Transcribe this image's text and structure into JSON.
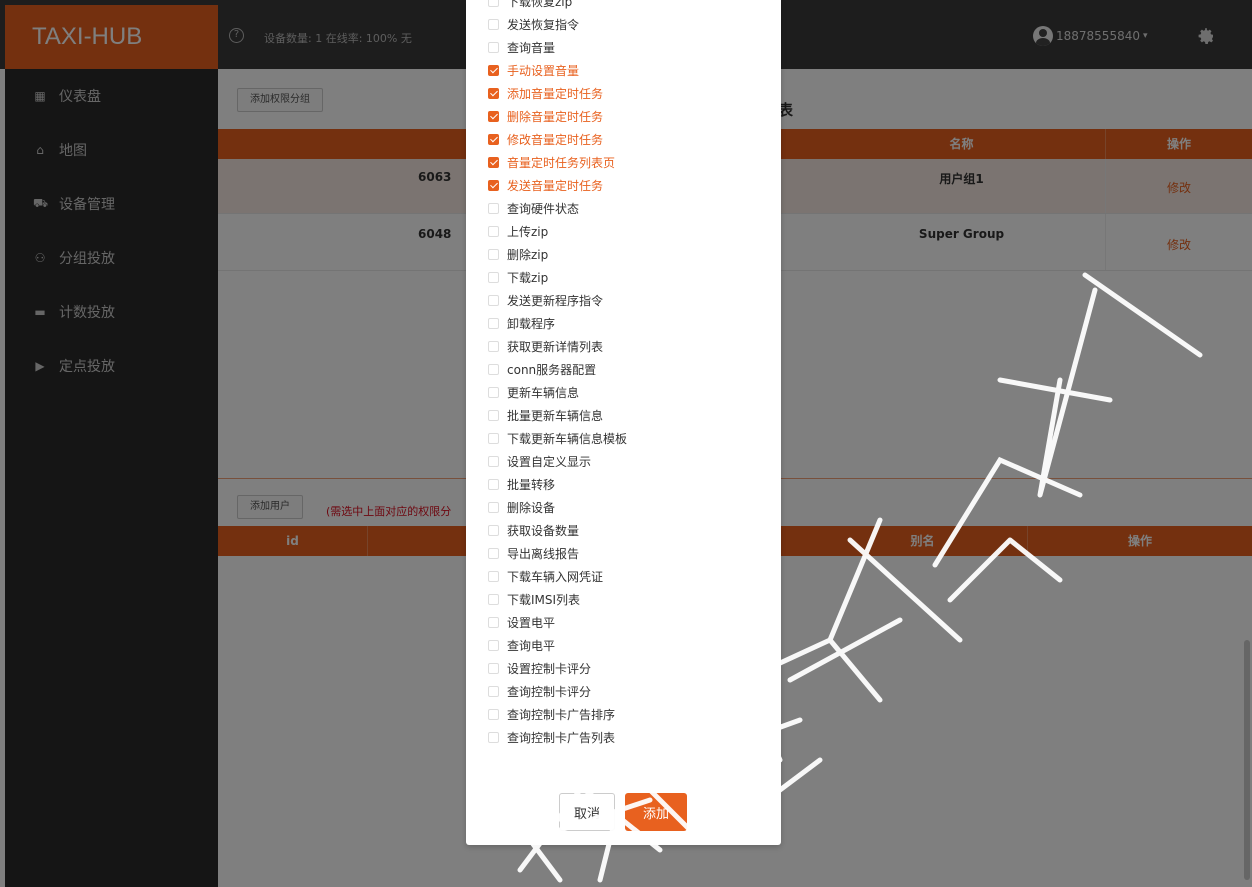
{
  "header": {
    "brand": "TAXI-HUB",
    "help_glyph": "?",
    "stats": "设备数量: 1  在线率: 100%  无",
    "user": "18878555840",
    "colors": {
      "accent": "#e8611f",
      "header_bg": "#3a3a3a",
      "sidebar_bg": "#2b2b2b"
    }
  },
  "sidebar": {
    "items": [
      {
        "label": "仪表盘",
        "icon": "dashboard-icon",
        "glyph": "▦"
      },
      {
        "label": "地图",
        "icon": "map-icon",
        "glyph": "⌂"
      },
      {
        "label": "设备管理",
        "icon": "car-icon",
        "glyph": "⛟"
      },
      {
        "label": "分组投放",
        "icon": "group-icon",
        "glyph": "⚇"
      },
      {
        "label": "计数投放",
        "icon": "counter-icon",
        "glyph": "▬"
      },
      {
        "label": "定点投放",
        "icon": "play-icon",
        "glyph": "▶"
      }
    ]
  },
  "groups": {
    "add_button": "添加权限分组",
    "title_partial": "表",
    "headers": [
      "名称",
      "操作"
    ],
    "rows": [
      {
        "id_partial": "6063",
        "name": "用户组1",
        "action": "修改"
      },
      {
        "id_partial": "6048",
        "name": "Super Group",
        "action": "修改"
      }
    ]
  },
  "users": {
    "add_button": "添加用户",
    "hint": "(需选中上面对应的权限分",
    "headers": [
      "id",
      "别名",
      "操作"
    ]
  },
  "modal": {
    "permissions": [
      {
        "label": "下载恢复zip",
        "checked": false
      },
      {
        "label": "发送恢复指令",
        "checked": false
      },
      {
        "label": "查询音量",
        "checked": false
      },
      {
        "label": "手动设置音量",
        "checked": true
      },
      {
        "label": "添加音量定时任务",
        "checked": true
      },
      {
        "label": "删除音量定时任务",
        "checked": true
      },
      {
        "label": "修改音量定时任务",
        "checked": true
      },
      {
        "label": "音量定时任务列表页",
        "checked": true
      },
      {
        "label": "发送音量定时任务",
        "checked": true
      },
      {
        "label": "查询硬件状态",
        "checked": false
      },
      {
        "label": "上传zip",
        "checked": false
      },
      {
        "label": "删除zip",
        "checked": false
      },
      {
        "label": "下载zip",
        "checked": false
      },
      {
        "label": "发送更新程序指令",
        "checked": false
      },
      {
        "label": "卸载程序",
        "checked": false
      },
      {
        "label": "获取更新详情列表",
        "checked": false
      },
      {
        "label": "conn服务器配置",
        "checked": false
      },
      {
        "label": "更新车辆信息",
        "checked": false
      },
      {
        "label": "批量更新车辆信息",
        "checked": false
      },
      {
        "label": "下载更新车辆信息模板",
        "checked": false
      },
      {
        "label": "设置自定义显示",
        "checked": false
      },
      {
        "label": "批量转移",
        "checked": false
      },
      {
        "label": "删除设备",
        "checked": false
      },
      {
        "label": "获取设备数量",
        "checked": false
      },
      {
        "label": "导出离线报告",
        "checked": false
      },
      {
        "label": "下载车辆入网凭证",
        "checked": false
      },
      {
        "label": "下载IMSI列表",
        "checked": false
      },
      {
        "label": "设置电平",
        "checked": false
      },
      {
        "label": "查询电平",
        "checked": false
      },
      {
        "label": "设置控制卡评分",
        "checked": false
      },
      {
        "label": "查询控制卡评分",
        "checked": false
      },
      {
        "label": "查询控制卡广告排序",
        "checked": false
      },
      {
        "label": "查询控制卡广告列表",
        "checked": false
      }
    ],
    "cancel_label": "取消",
    "add_label": "添加"
  },
  "watermark": {
    "text": "有限公司科技"
  }
}
